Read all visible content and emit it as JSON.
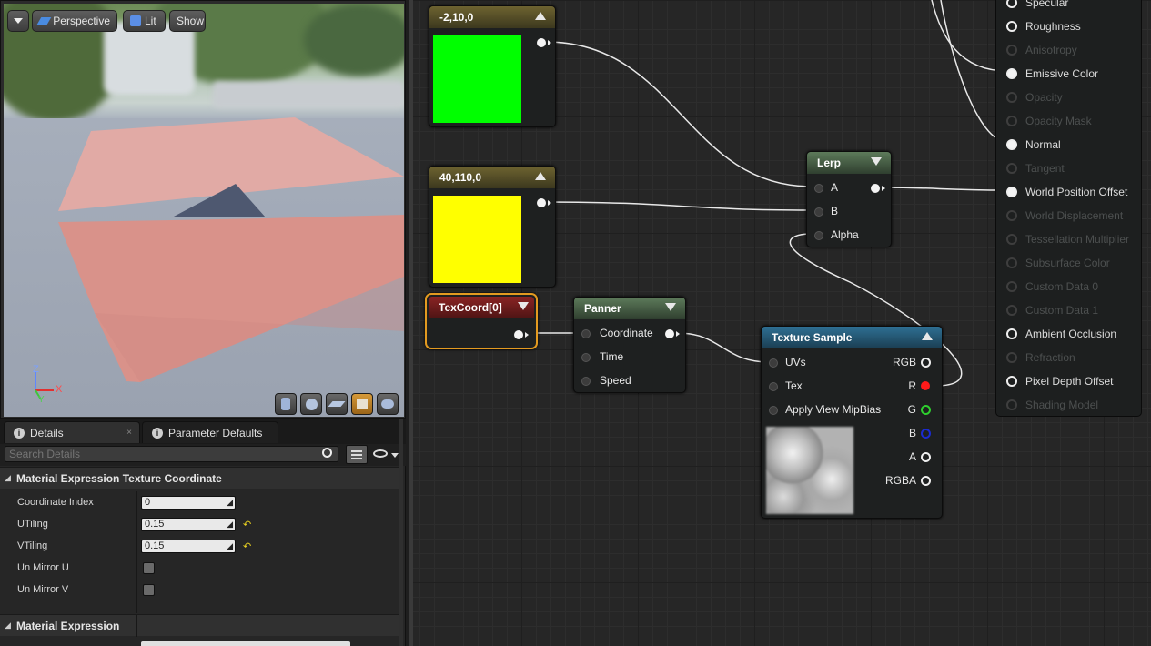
{
  "viewport": {
    "toolbar": {
      "perspective_label": "Perspective",
      "lit_label": "Lit",
      "show_label": "Show"
    },
    "axes": {
      "z": "Z",
      "x": "X",
      "y": "Y"
    }
  },
  "details": {
    "tabs": [
      {
        "label": "Details"
      },
      {
        "label": "Parameter Defaults"
      }
    ],
    "search": {
      "placeholder": "Search Details"
    },
    "categories": [
      {
        "label": "Material Expression Texture Coordinate"
      },
      {
        "label": "Material Expression"
      }
    ],
    "properties": [
      {
        "label": "Coordinate Index",
        "value": "0"
      },
      {
        "label": "UTiling",
        "value": "0.15"
      },
      {
        "label": "VTiling",
        "value": "0.15"
      },
      {
        "label": "Un Mirror U"
      },
      {
        "label": "Un Mirror V"
      }
    ]
  },
  "graph": {
    "nodes": {
      "const_green": {
        "title": "-2,10,0",
        "color": "#00ff00"
      },
      "const_yellow": {
        "title": "40,110,0",
        "color": "#ffff00"
      },
      "texcoord": {
        "title": "TexCoord[0]"
      },
      "panner": {
        "title": "Panner",
        "inputs": [
          "Coordinate",
          "Time",
          "Speed"
        ]
      },
      "lerp": {
        "title": "Lerp",
        "inputs": [
          "A",
          "B",
          "Alpha"
        ]
      },
      "texture_sample": {
        "title": "Texture Sample",
        "inputs": [
          "UVs",
          "Tex",
          "Apply View MipBias"
        ],
        "outputs": [
          "RGB",
          "R",
          "G",
          "B",
          "A",
          "RGBA"
        ]
      }
    },
    "result_pins": [
      {
        "label": "Specular",
        "active": true
      },
      {
        "label": "Roughness",
        "active": true
      },
      {
        "label": "Anisotropy",
        "active": false
      },
      {
        "label": "Emissive Color",
        "active": true,
        "connected": true
      },
      {
        "label": "Opacity",
        "active": false
      },
      {
        "label": "Opacity Mask",
        "active": false
      },
      {
        "label": "Normal",
        "active": true,
        "connected": true
      },
      {
        "label": "Tangent",
        "active": false
      },
      {
        "label": "World Position Offset",
        "active": true,
        "connected": true
      },
      {
        "label": "World Displacement",
        "active": false
      },
      {
        "label": "Tessellation Multiplier",
        "active": false
      },
      {
        "label": "Subsurface Color",
        "active": false
      },
      {
        "label": "Custom Data 0",
        "active": false
      },
      {
        "label": "Custom Data 1",
        "active": false
      },
      {
        "label": "Ambient Occlusion",
        "active": true
      },
      {
        "label": "Refraction",
        "active": false
      },
      {
        "label": "Pixel Depth Offset",
        "active": true
      },
      {
        "label": "Shading Model",
        "active": false
      }
    ]
  }
}
